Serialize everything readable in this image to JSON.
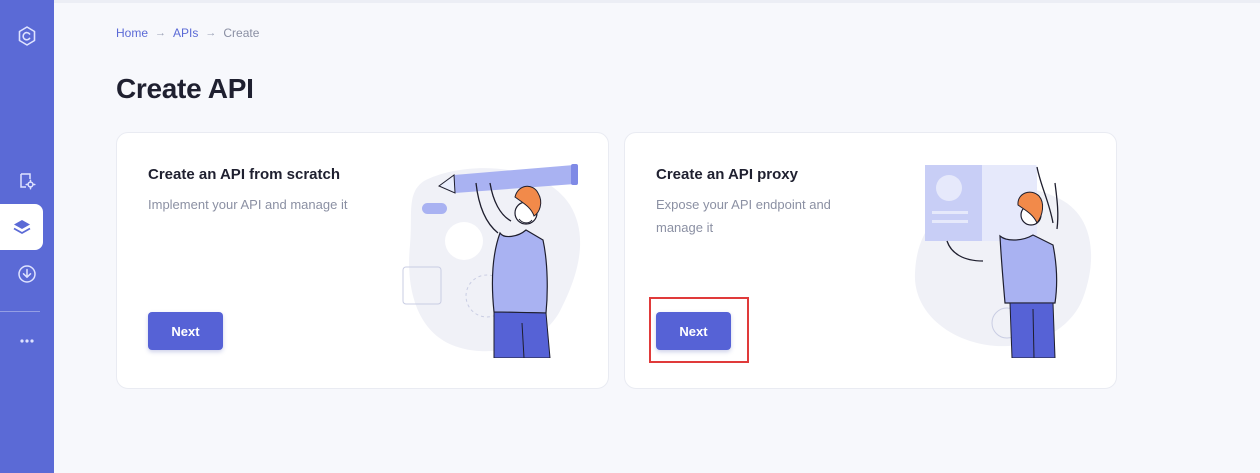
{
  "colors": {
    "sidebar": "#5b6ad6",
    "accent": "#5662d6",
    "highlight": "#e03a3a",
    "background": "#f7f8fc"
  },
  "sidebar": {
    "items": [
      {
        "icon": "logo-icon"
      },
      {
        "icon": "settings-icon"
      },
      {
        "icon": "layers-icon",
        "active": true
      },
      {
        "icon": "download-icon"
      },
      {
        "icon": "more-icon"
      }
    ]
  },
  "breadcrumb": {
    "home": "Home",
    "apis": "APIs",
    "current": "Create",
    "separator": "→"
  },
  "page": {
    "title": "Create API"
  },
  "cards": [
    {
      "title": "Create an API from scratch",
      "description": "Implement your API and manage it",
      "button": "Next"
    },
    {
      "title": "Create an API proxy",
      "description": "Expose your API endpoint and manage it",
      "button": "Next",
      "highlighted": true
    }
  ]
}
